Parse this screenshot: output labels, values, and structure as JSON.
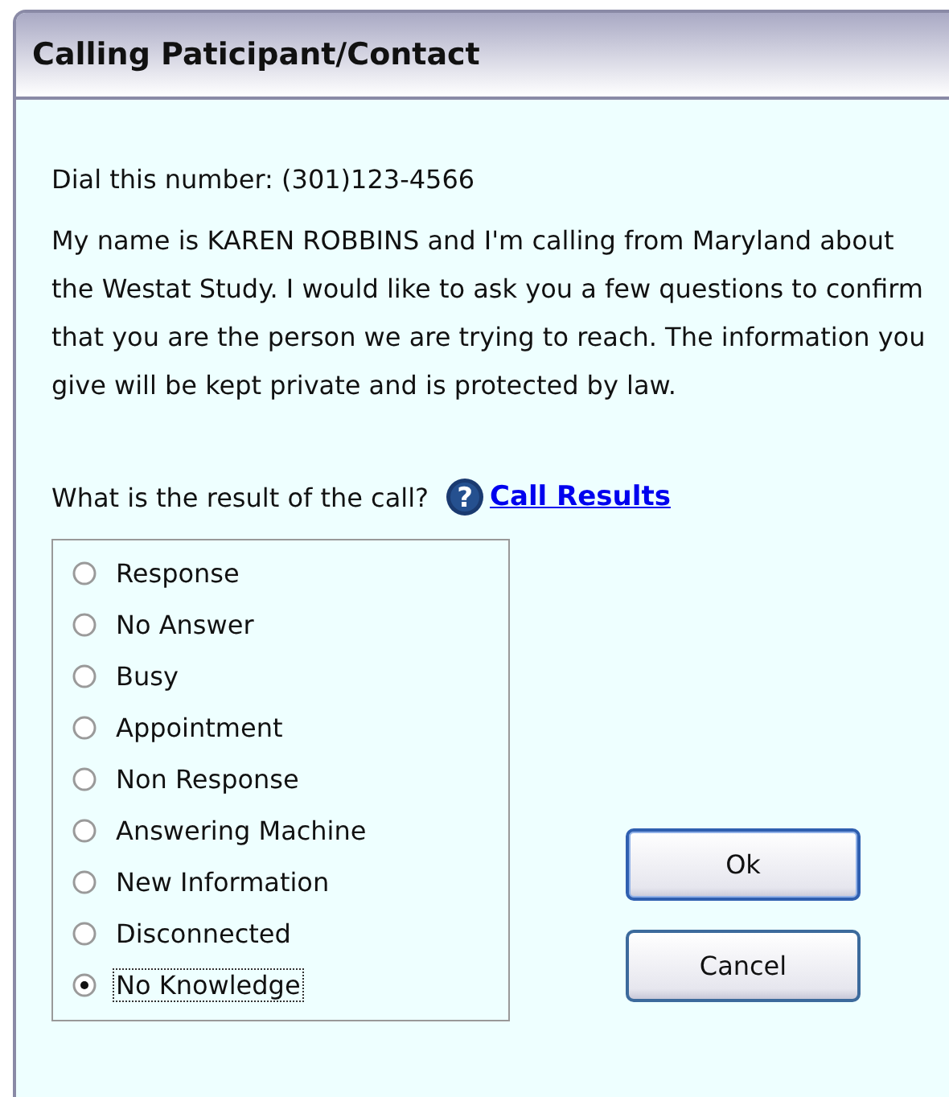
{
  "window": {
    "title": "Calling Paticipant/Contact"
  },
  "dial_prompt": "Dial this number: (301)123-4566",
  "script_text": "My name is KAREN ROBBINS and I'm calling from Maryland about the Westat Study. I would like to ask you a few questions to confirm that you are the person we are trying to reach. The information you give will be kept private and is protected by law.",
  "question": "What is the result of the call?",
  "help_icon": "?",
  "help_link": "Call Results",
  "results": [
    {
      "label": "Response",
      "selected": false
    },
    {
      "label": "No Answer",
      "selected": false
    },
    {
      "label": "Busy",
      "selected": false
    },
    {
      "label": "Appointment",
      "selected": false
    },
    {
      "label": "Non Response",
      "selected": false
    },
    {
      "label": "Answering Machine",
      "selected": false
    },
    {
      "label": "New Information",
      "selected": false
    },
    {
      "label": "Disconnected",
      "selected": false
    },
    {
      "label": "No Knowledge",
      "selected": true
    }
  ],
  "buttons": [
    "Ok",
    "Cancel"
  ]
}
